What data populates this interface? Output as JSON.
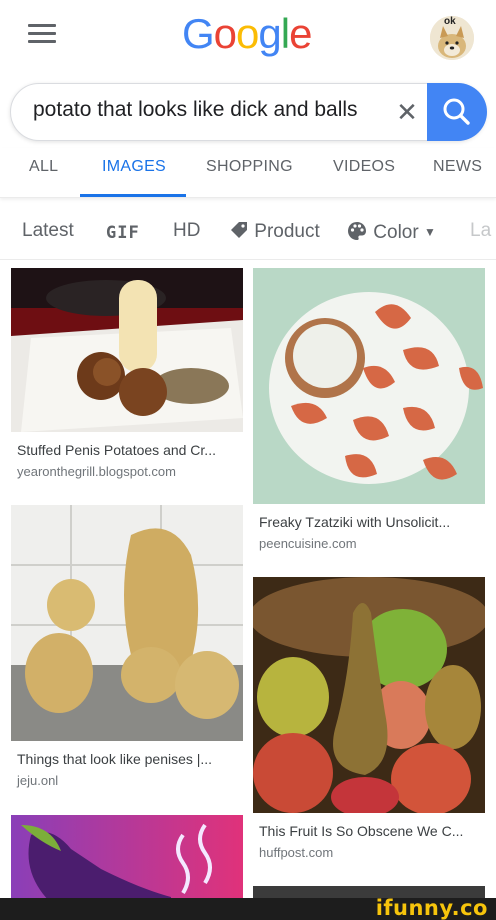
{
  "header": {
    "logo": [
      "G",
      "o",
      "o",
      "g",
      "l",
      "e"
    ],
    "avatar_badge": "ok"
  },
  "search": {
    "query": "potato that looks like dick and balls"
  },
  "tabs": [
    {
      "label": "ALL",
      "active": false
    },
    {
      "label": "IMAGES",
      "active": true
    },
    {
      "label": "SHOPPING",
      "active": false
    },
    {
      "label": "VIDEOS",
      "active": false
    },
    {
      "label": "NEWS",
      "active": false
    }
  ],
  "chips": {
    "latest": "Latest",
    "gif": "GIF",
    "hd": "HD",
    "product": "Product",
    "color": "Color",
    "partial": "La"
  },
  "results": [
    {
      "title": "Stuffed Penis Potatoes and Cr...",
      "source": "yearonthegrill.blogspot.com"
    },
    {
      "title": "Freaky Tzatziki with Unsolicit...",
      "source": "peencuisine.com"
    },
    {
      "title": "Things that look like penises |...",
      "source": "jeju.onl"
    },
    {
      "title": "This Fruit Is So Obscene We C...",
      "source": "huffpost.com"
    }
  ],
  "footer": {
    "watermark": "ifunny.co"
  },
  "colors": {
    "accent": "#1a73e8",
    "search_button": "#4285F4",
    "watermark": "#f6c40c"
  }
}
